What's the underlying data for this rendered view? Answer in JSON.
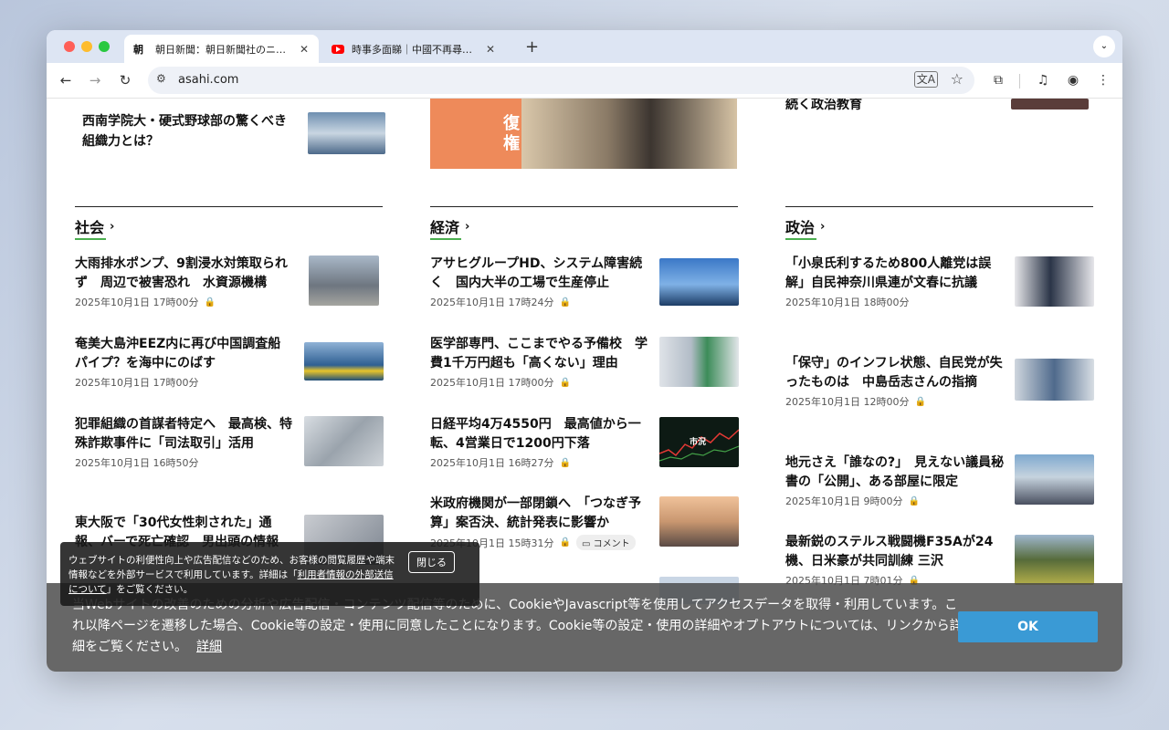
{
  "browser": {
    "tabs": [
      {
        "favicon": "朝",
        "title": "朝日新聞：朝日新聞社のニュース",
        "close": "✕"
      },
      {
        "favicon": "youtube-icon",
        "title": "時事多面睇｜中國不再尋求世貿",
        "close": "✕"
      }
    ],
    "new_tab": "+",
    "tab_menu": "⌄",
    "url": "asahi.com",
    "nav": {
      "back": "←",
      "forward": "→",
      "reload": "↻"
    },
    "icons": {
      "translate": "文A",
      "star": "☆",
      "extensions": "⧉",
      "media": "♫",
      "profile": "◉",
      "menu": "⋮",
      "tune": "⚙"
    }
  },
  "page": {
    "top_fragments": {
      "col1_headline": "西南学院大・硬式野球部の驚くべき組織力とは？",
      "banner_text": "復権",
      "col3_fragment": "続く政治教育"
    },
    "sections": [
      {
        "name": "社会",
        "chevron": "›",
        "articles": [
          {
            "headline": "大雨排水ポンプ、9割浸水対策取られず　周辺で被害恐れ　水資源機構",
            "date": "2025年10月1日 17時00分",
            "locked": true
          },
          {
            "headline": "奄美大島沖EEZ内に再び中国調査船　パイプ？を海中にのばす",
            "date": "2025年10月1日 17時00分",
            "locked": false
          },
          {
            "headline": "犯罪組織の首謀者特定へ　最高検、特殊詐欺事件に「司法取引」活用",
            "date": "2025年10月1日 16時50分",
            "locked": false
          },
          {
            "headline": "東大阪で「30代女性刺された」通報、バーで死亡確認　男出頭の情報",
            "date": "",
            "locked": false
          }
        ]
      },
      {
        "name": "経済",
        "chevron": "›",
        "articles": [
          {
            "headline": "アサヒグループHD、システム障害続く　国内大半の工場で生産停止",
            "date": "2025年10月1日 17時24分",
            "locked": true
          },
          {
            "headline": "医学部専門、ここまでやる予備校　学費1千万円超も「高くない」理由",
            "date": "2025年10月1日 17時00分",
            "locked": true
          },
          {
            "headline": "日経平均4万4550円　最高値から一転、4営業日で1200円下落",
            "date": "2025年10月1日 16時27分",
            "locked": true
          },
          {
            "headline": "米政府機関が一部閉鎖へ　「つなぎ予算」案否決、統計発表に影響か",
            "date": "2025年10月1日 15時31分",
            "locked": true,
            "comment": "コメント"
          }
        ]
      },
      {
        "name": "政治",
        "chevron": "›",
        "articles": [
          {
            "headline": "「小泉氏利するため800人離党は誤解」自民神奈川県連が文春に抗議",
            "date": "2025年10月1日 18時00分",
            "locked": false
          },
          {
            "headline": "「保守」のインフレ状態、自民党が失ったものは　中島岳志さんの指摘",
            "date": "2025年10月1日 12時00分",
            "locked": true
          },
          {
            "headline": "地元さえ「誰なの?」　見えない議員秘書の「公開」、ある部屋に限定",
            "date": "2025年10月1日 9時00分",
            "locked": true
          },
          {
            "headline": "最新鋭のステルス戦闘機F35Aが24機、日米豪が共同訓練 三沢",
            "date": "2025年10月1日 7時01分",
            "locked": true
          }
        ]
      }
    ],
    "thumb_texts": {
      "market": "市況"
    }
  },
  "notice": {
    "text_parts": [
      "ウェブサイトの利便性向上や広告配信などのため、お客様の閲覧履歴や端末情報などを外部サービスで利用しています。詳細は「",
      "利用者情報の外部送信について",
      "」をご覧ください。"
    ],
    "close_label": "閉じる"
  },
  "cookie_bar": {
    "text": "当Webサイトの改善のための分析や広告配信・コンテンツ配信等のために、CookieやJavascript等を使用してアクセスデータを取得・利用しています。これ以降ページを遷移した場合、Cookie等の設定・使用に同意したことになります。Cookie等の設定・使用の詳細やオプトアウトについては、リンクから詳細をご覧ください。",
    "detail_link": "詳細",
    "ok_label": "OK"
  },
  "colors": {
    "accent_blue": "#3a9ad5",
    "underline_green": "#4caf50",
    "underline_red": "#e53935",
    "lock": "#e0a030"
  }
}
